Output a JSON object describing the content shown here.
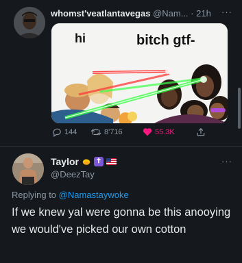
{
  "tweet": {
    "author_name": "whomst'veatlantavegas",
    "author_handle": "@Nam...",
    "separator": "·",
    "time": "21h",
    "more": "···",
    "meme": {
      "left_text": "hi",
      "right_text": "bitch gtf-"
    },
    "stats": {
      "replies": "144",
      "retweets": "8'716",
      "likes": "55.3K"
    }
  },
  "reply": {
    "author_name": "Taylor",
    "author_handle": "@DeezTay",
    "more": "···",
    "replying_prefix": "Replying to",
    "replying_handle": "@Namastaywoke",
    "text": "If we knew yal were gonna be this anooying we would've picked our own cotton"
  },
  "colors": {
    "background": "#15181c",
    "text": "#e7e9ea",
    "muted": "#8b98a5",
    "link": "#1d9bf0",
    "like": "#f91880",
    "laser_red": "#ff2a2a",
    "laser_green": "#3cff4a"
  },
  "icons": {
    "reply": "reply-icon",
    "retweet": "retweet-icon",
    "like": "heart-icon",
    "share": "share-icon"
  }
}
